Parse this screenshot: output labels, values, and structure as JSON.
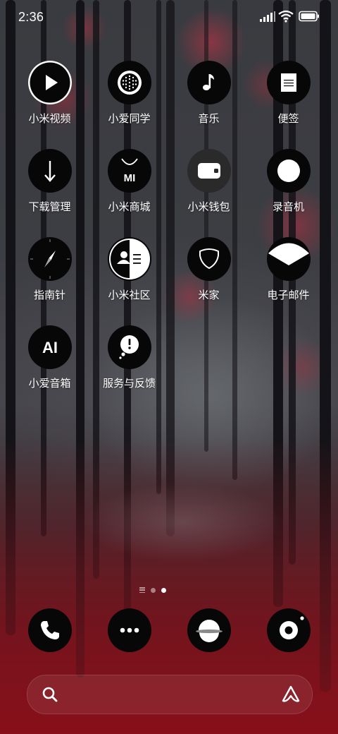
{
  "status_bar": {
    "time": "2:36"
  },
  "apps": [
    [
      {
        "label": "小米视频",
        "icon": "play-icon"
      },
      {
        "label": "小爱同学",
        "icon": "speaker-grille-icon"
      },
      {
        "label": "音乐",
        "icon": "music-note-icon"
      },
      {
        "label": "便签",
        "icon": "note-icon"
      }
    ],
    [
      {
        "label": "下载管理",
        "icon": "download-arrow-icon"
      },
      {
        "label": "小米商城",
        "icon": "mi-bag-icon",
        "icon_text": "MI"
      },
      {
        "label": "小米钱包",
        "icon": "wallet-icon"
      },
      {
        "label": "录音机",
        "icon": "record-circle-icon"
      }
    ],
    [
      {
        "label": "指南针",
        "icon": "compass-icon"
      },
      {
        "label": "小米社区",
        "icon": "community-icon"
      },
      {
        "label": "米家",
        "icon": "shield-home-icon"
      },
      {
        "label": "电子邮件",
        "icon": "envelope-icon"
      }
    ],
    [
      {
        "label": "小爱音箱",
        "icon": "ai-speaker-icon",
        "icon_text": "AI"
      },
      {
        "label": "服务与反馈",
        "icon": "feedback-bubble-icon"
      }
    ]
  ],
  "dock": [
    {
      "name": "phone",
      "icon": "phone-icon"
    },
    {
      "name": "messages",
      "icon": "more-dots-icon"
    },
    {
      "name": "browser",
      "icon": "planet-icon"
    },
    {
      "name": "camera",
      "icon": "camera-lens-icon"
    }
  ],
  "page_indicator": {
    "pages": 2,
    "active": 2
  },
  "colors": {
    "icon_bg": "#070707",
    "icon_fg": "#ffffff",
    "wallpaper_accent": "#b8202f"
  }
}
